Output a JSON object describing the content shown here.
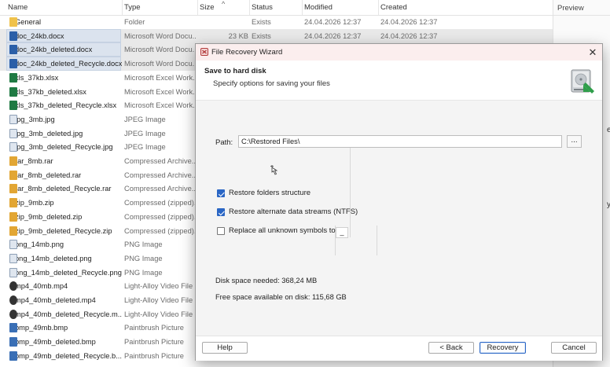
{
  "list": {
    "columns": {
      "name": "Name",
      "type": "Type",
      "size": "Size",
      "status": "Status",
      "modified": "Modified",
      "created": "Created"
    },
    "rows": [
      {
        "name": "General",
        "type": "Folder",
        "size": "",
        "status": "Exists",
        "modified": "24.04.2026 12:37",
        "created": "24.04.2026 12:37",
        "icon": "folder-icon",
        "selected": false
      },
      {
        "name": "doc_24kb.docx",
        "type": "Microsoft Word Docu...",
        "size": "23 KB",
        "status": "Exists",
        "modified": "24.04.2026 12:37",
        "created": "24.04.2026 12:37",
        "icon": "word-icon",
        "selected": true
      },
      {
        "name": "doc_24kb_deleted.docx",
        "type": "Microsoft Word Docu...",
        "size": "",
        "status": "",
        "modified": "",
        "created": "",
        "icon": "word-icon",
        "selected": true
      },
      {
        "name": "doc_24kb_deleted_Recycle.docx",
        "type": "Microsoft Word Docu...",
        "size": "",
        "status": "",
        "modified": "",
        "created": "",
        "icon": "word-icon",
        "selected": true
      },
      {
        "name": "xls_37kb.xlsx",
        "type": "Microsoft Excel Work...",
        "size": "",
        "status": "",
        "modified": "",
        "created": "",
        "icon": "excel-icon",
        "selected": false
      },
      {
        "name": "xls_37kb_deleted.xlsx",
        "type": "Microsoft Excel Work...",
        "size": "",
        "status": "",
        "modified": "",
        "created": "",
        "icon": "excel-icon",
        "selected": false
      },
      {
        "name": "xls_37kb_deleted_Recycle.xlsx",
        "type": "Microsoft Excel Work...",
        "size": "",
        "status": "",
        "modified": "",
        "created": "",
        "icon": "excel-icon",
        "selected": false
      },
      {
        "name": "jpg_3mb.jpg",
        "type": "JPEG Image",
        "size": "",
        "status": "",
        "modified": "",
        "created": "",
        "icon": "image-icon",
        "selected": false
      },
      {
        "name": "jpg_3mb_deleted.jpg",
        "type": "JPEG Image",
        "size": "",
        "status": "",
        "modified": "",
        "created": "",
        "icon": "image-icon",
        "selected": false
      },
      {
        "name": "jpg_3mb_deleted_Recycle.jpg",
        "type": "JPEG Image",
        "size": "",
        "status": "",
        "modified": "",
        "created": "",
        "icon": "image-icon",
        "selected": false
      },
      {
        "name": "rar_8mb.rar",
        "type": "Compressed Archive...",
        "size": "",
        "status": "",
        "modified": "",
        "created": "",
        "icon": "archive-icon",
        "selected": false
      },
      {
        "name": "rar_8mb_deleted.rar",
        "type": "Compressed Archive...",
        "size": "",
        "status": "",
        "modified": "",
        "created": "",
        "icon": "archive-icon",
        "selected": false
      },
      {
        "name": "rar_8mb_deleted_Recycle.rar",
        "type": "Compressed Archive...",
        "size": "",
        "status": "",
        "modified": "",
        "created": "",
        "icon": "archive-icon",
        "selected": false
      },
      {
        "name": "zip_9mb.zip",
        "type": "Compressed (zipped)...",
        "size": "",
        "status": "",
        "modified": "",
        "created": "",
        "icon": "archive-icon",
        "selected": false
      },
      {
        "name": "zip_9mb_deleted.zip",
        "type": "Compressed (zipped)...",
        "size": "",
        "status": "",
        "modified": "",
        "created": "",
        "icon": "archive-icon",
        "selected": false
      },
      {
        "name": "zip_9mb_deleted_Recycle.zip",
        "type": "Compressed (zipped)...",
        "size": "",
        "status": "",
        "modified": "",
        "created": "",
        "icon": "archive-icon",
        "selected": false
      },
      {
        "name": "png_14mb.png",
        "type": "PNG Image",
        "size": "",
        "status": "",
        "modified": "",
        "created": "",
        "icon": "image-icon",
        "selected": false
      },
      {
        "name": "png_14mb_deleted.png",
        "type": "PNG Image",
        "size": "",
        "status": "",
        "modified": "",
        "created": "",
        "icon": "image-icon",
        "selected": false
      },
      {
        "name": "png_14mb_deleted_Recycle.png",
        "type": "PNG Image",
        "size": "",
        "status": "",
        "modified": "",
        "created": "",
        "icon": "image-icon",
        "selected": false
      },
      {
        "name": "mp4_40mb.mp4",
        "type": "Light-Alloy Video File",
        "size": "",
        "status": "",
        "modified": "",
        "created": "",
        "icon": "video-icon",
        "selected": false
      },
      {
        "name": "mp4_40mb_deleted.mp4",
        "type": "Light-Alloy Video File",
        "size": "",
        "status": "",
        "modified": "",
        "created": "",
        "icon": "video-icon",
        "selected": false
      },
      {
        "name": "mp4_40mb_deleted_Recycle.m...",
        "type": "Light-Alloy Video File",
        "size": "",
        "status": "",
        "modified": "",
        "created": "",
        "icon": "video-icon",
        "selected": false
      },
      {
        "name": "bmp_49mb.bmp",
        "type": "Paintbrush Picture",
        "size": "",
        "status": "",
        "modified": "",
        "created": "",
        "icon": "bmp-icon",
        "selected": false
      },
      {
        "name": "bmp_49mb_deleted.bmp",
        "type": "Paintbrush Picture",
        "size": "",
        "status": "",
        "modified": "",
        "created": "",
        "icon": "bmp-icon",
        "selected": false
      },
      {
        "name": "bmp_49mb_deleted_Recycle.b...",
        "type": "Paintbrush Picture",
        "size": "",
        "status": "",
        "modified": "",
        "created": "",
        "icon": "bmp-icon",
        "selected": false
      }
    ]
  },
  "preview": {
    "title": "Preview",
    "fragment1": "e",
    "fragment2": "y"
  },
  "dialog": {
    "title": "File Recovery Wizard",
    "close": "✕",
    "header_title": "Save to hard disk",
    "header_subtitle": "Specify options for saving your files",
    "path_label": "Path:",
    "path_value": "C:\\Restored Files\\",
    "browse_label": "...",
    "options": [
      {
        "label": "Restore folders structure",
        "checked": true
      },
      {
        "label": "Restore alternate data streams (NTFS)",
        "checked": true
      },
      {
        "label": "Replace all unknown symbols to",
        "checked": false
      }
    ],
    "replace_symbol": "_",
    "disk_needed": "Disk space needed: 368,24 MB",
    "disk_free": "Free space available on disk: 115,68 GB",
    "buttons": {
      "help": "Help",
      "back": "< Back",
      "recovery": "Recovery",
      "cancel": "Cancel"
    },
    "accent_color": "#2a66c5"
  }
}
